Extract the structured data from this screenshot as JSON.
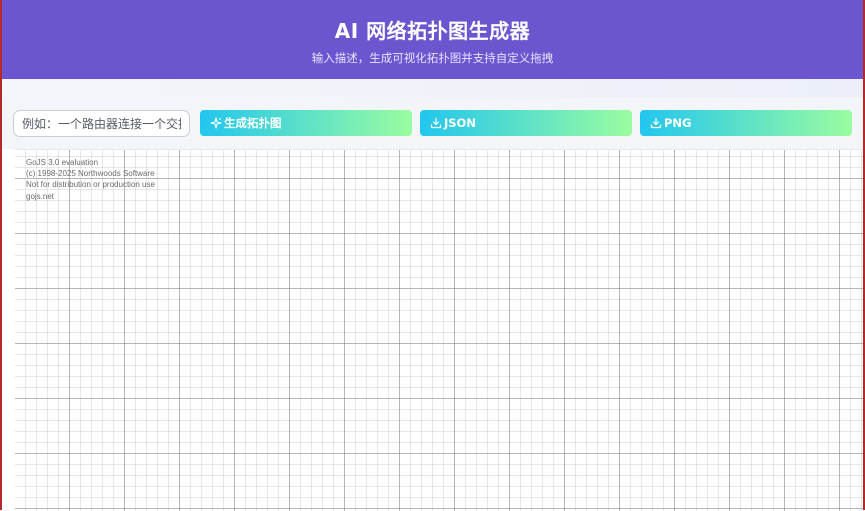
{
  "header": {
    "title": "AI 网络拓扑图生成器",
    "subtitle": "输入描述，生成可视化拓扑图并支持自定义拖拽"
  },
  "toolbar": {
    "input_placeholder": "例如：一个路由器连接一个交换机",
    "generate_label": "生成拓扑图",
    "json_label": "JSON",
    "png_label": "PNG"
  },
  "canvas": {
    "watermark": [
      "GoJS 3.0 evaluation",
      "(c) 1998-2025 Northwoods Software",
      "Not for distribution or production use",
      "gojs.net"
    ]
  },
  "colors": {
    "header_bg": "#6c55cf",
    "button_gradient_start": "#22c6ee",
    "button_gradient_end": "#9afda0"
  },
  "icons": {
    "generate": "sparkle-icon",
    "json": "download-icon",
    "png": "download-icon"
  }
}
